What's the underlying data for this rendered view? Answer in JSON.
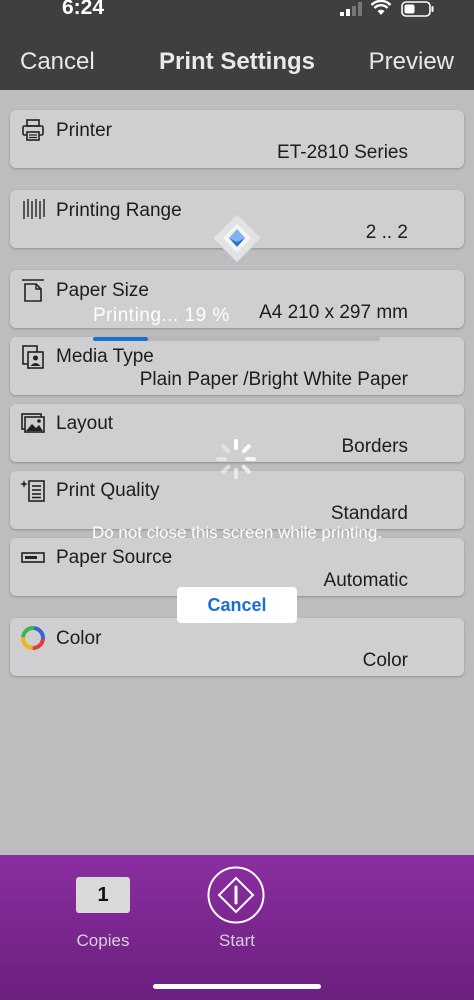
{
  "status_bar": {
    "time": "6:24"
  },
  "nav": {
    "cancel_label": "Cancel",
    "title": "Print Settings",
    "preview_label": "Preview"
  },
  "settings": {
    "printer": {
      "label": "Printer",
      "value": "ET-2810 Series",
      "icon": "printer-icon"
    },
    "printing_range": {
      "label": "Printing Range",
      "value": "2 .. 2",
      "icon": "pages-icon"
    },
    "paper_size": {
      "label": "Paper Size",
      "value": "A4 210 x 297 mm",
      "icon": "paper-size-icon"
    },
    "media_type": {
      "label": "Media Type",
      "value": "Plain Paper /Bright White Paper",
      "icon": "media-type-icon"
    },
    "layout": {
      "label": "Layout",
      "value": "Borders",
      "icon": "image-icon"
    },
    "print_quality": {
      "label": "Print Quality",
      "value": "Standard",
      "icon": "print-quality-icon"
    },
    "paper_source": {
      "label": "Paper Source",
      "value": "Automatic",
      "icon": "tray-icon"
    },
    "color": {
      "label": "Color",
      "value": "Color",
      "icon": "color-wheel-icon"
    }
  },
  "print_overlay": {
    "status_text": "Printing...  19 %",
    "progress_percent": 19,
    "warning": "Do not close this screen while printing.",
    "cancel_label": "Cancel",
    "progress_color": "#1f6fd1"
  },
  "toolbar": {
    "copies_value": "1",
    "copies_label": "Copies",
    "start_label": "Start",
    "background": "#7a2690"
  }
}
